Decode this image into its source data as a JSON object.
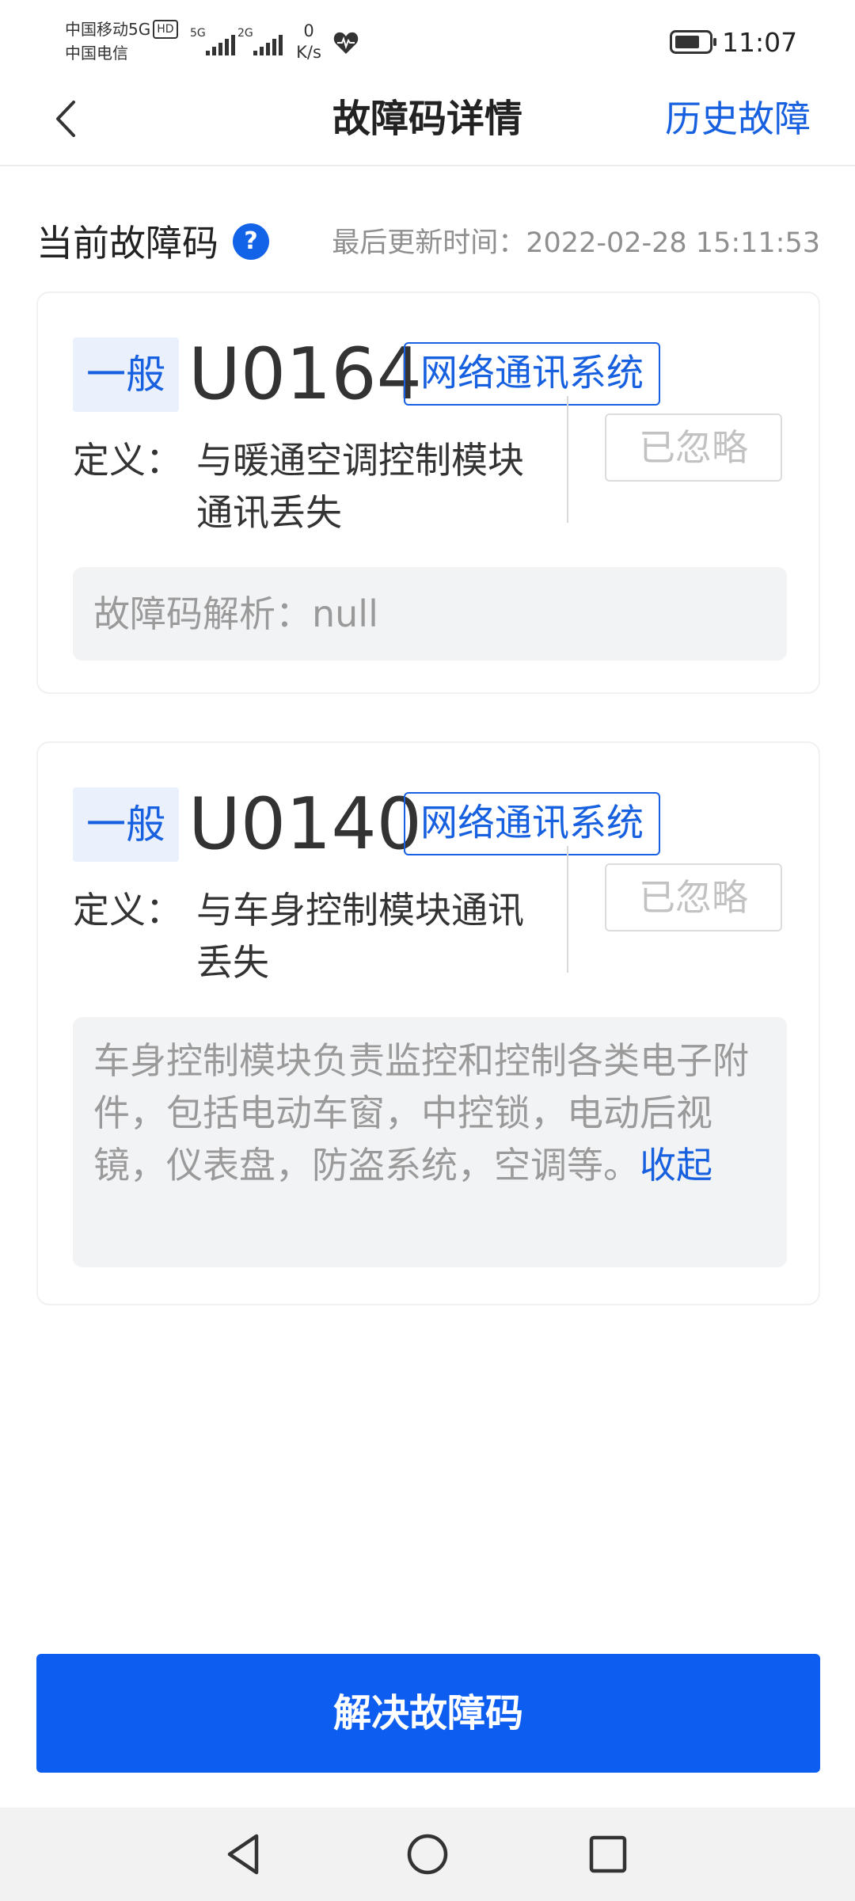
{
  "status_bar": {
    "carrier_1": "中国移动5G",
    "hd_badge": "HD",
    "carrier_2": "中国电信",
    "signal_1_tag": "5G",
    "signal_2_tag": "2G",
    "net_speed_value": "0",
    "net_speed_unit": "K/s",
    "time": "11:07",
    "icons": [
      "signal-icon",
      "health-icon",
      "battery-icon"
    ]
  },
  "nav": {
    "title": "故障码详情",
    "right_link": "历史故障",
    "back_icon": "chevron-left-icon"
  },
  "section": {
    "title": "当前故障码",
    "help_icon": "?",
    "last_update": "最后更新时间：2022-02-28 15:11:53"
  },
  "faults": [
    {
      "level": "一般",
      "code": "U0164",
      "system": "网络通讯系统",
      "status": "已忽略",
      "definition_label": "定义：",
      "definition": "与暖通空调控制模块通讯丢失",
      "analysis": "故障码解析：null"
    },
    {
      "level": "一般",
      "code": "U0140",
      "system": "网络通讯系统",
      "status": "已忽略",
      "definition_label": "定义：",
      "definition": "与车身控制模块通讯丢失",
      "analysis": "车身控制模块负责监控和控制各类电子附件，包括电动车窗，中控锁，电动后视镜，仪表盘，防盗系统，空调等。",
      "collapse": "收起"
    }
  ],
  "primary_button": "解决故障码",
  "colors": {
    "accent": "#1760e0",
    "button": "#0d5ef0",
    "badge_bg": "#eaf1fd",
    "muted_text": "#9a9a9a",
    "box_bg": "#f2f3f5"
  }
}
